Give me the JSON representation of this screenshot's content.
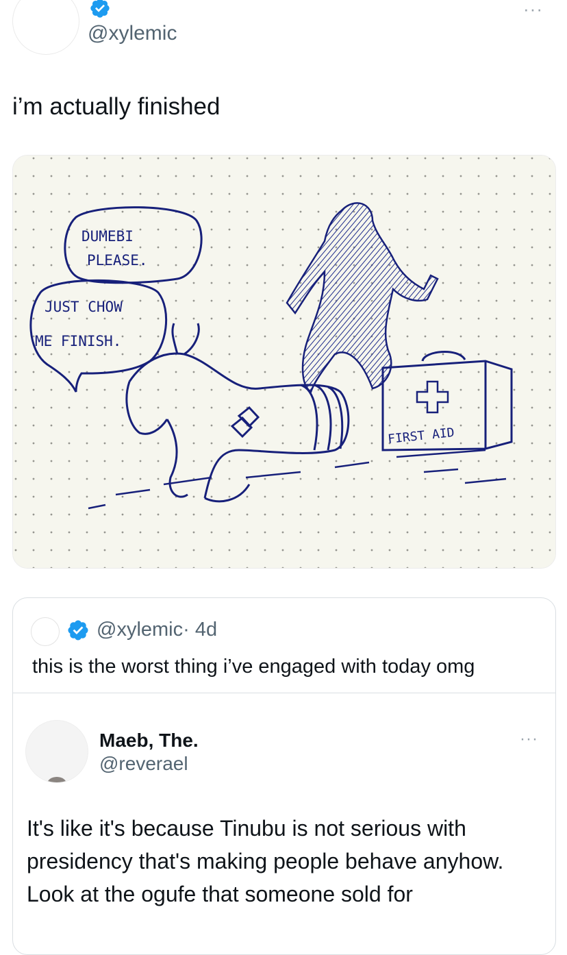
{
  "post": {
    "handle": "@xylemic",
    "text": "i’m actually finished",
    "more_label": "···",
    "image": {
      "speech_bubble_1": [
        "DUMEBI",
        "PLEASE."
      ],
      "speech_bubble_2": [
        "JUST CHOW",
        "ME FINISH."
      ],
      "first_aid_label": "FIRST AID"
    }
  },
  "quote": {
    "handle": "@xylemic",
    "time": "· 4d",
    "text": "this is the worst thing i’ve engaged with today omg",
    "embedded": {
      "name": "Maeb, The.",
      "handle": "@reverael",
      "more_label": "···",
      "text": "It's like it's because Tinubu is not serious with presidency that's making people behave anyhow. Look at the ogufe that someone sold for"
    }
  },
  "colors": {
    "verified": "#1d9bf0",
    "secondary_text": "#536471",
    "ink": "#17207a"
  }
}
